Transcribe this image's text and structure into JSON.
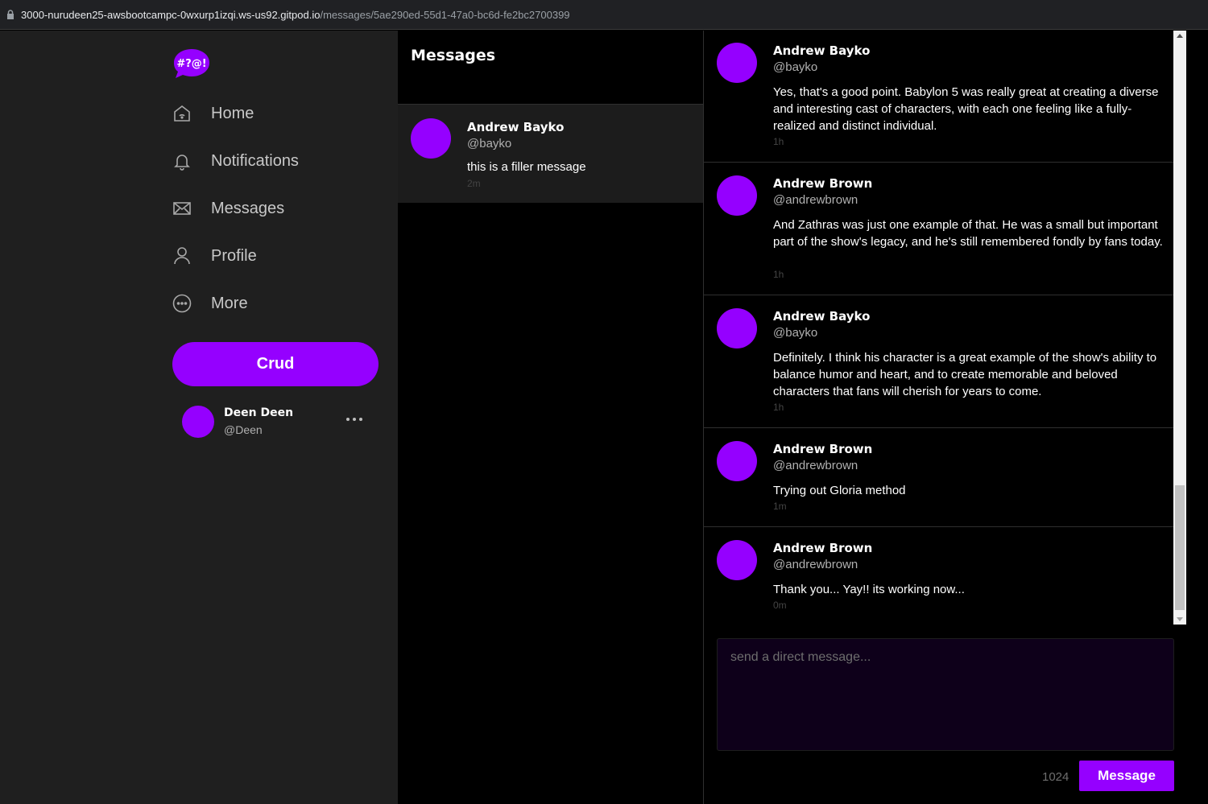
{
  "browser": {
    "url_host": "3000-nurudeen25-awsbootcampc-0wxurp1izqi.ws-us92.gitpod.io",
    "url_path": "/messages/5ae290ed-55d1-47a0-bc6d-fe2bc2700399"
  },
  "sidebar": {
    "logo_text": "#?@!",
    "items": [
      {
        "label": "Home",
        "icon": "home-icon"
      },
      {
        "label": "Notifications",
        "icon": "bell-icon"
      },
      {
        "label": "Messages",
        "icon": "envelope-icon"
      },
      {
        "label": "Profile",
        "icon": "user-icon"
      },
      {
        "label": "More",
        "icon": "more-circle-icon"
      }
    ],
    "crud_label": "Crud",
    "profile": {
      "name": "Deen Deen",
      "handle": "@Deen"
    }
  },
  "groups": {
    "title": "Messages",
    "items": [
      {
        "name": "Andrew Bayko",
        "handle": "@bayko",
        "message": "this is a filler message",
        "time": "2m"
      }
    ]
  },
  "feed": {
    "messages": [
      {
        "name": "Andrew Bayko",
        "handle": "@bayko",
        "text": "Yes, that's a good point. Babylon 5 was really great at creating a diverse and interesting cast of characters, with each one feeling like a fully-realized and distinct individual.",
        "time": "1h"
      },
      {
        "name": "Andrew Brown",
        "handle": "@andrewbrown",
        "text": "And Zathras was just one example of that. He was a small but important part of the show's legacy, and he's still remembered fondly by fans today.",
        "time": "1h"
      },
      {
        "name": "Andrew Bayko",
        "handle": "@bayko",
        "text": "Definitely. I think his character is a great example of the show's ability to balance humor and heart, and to create memorable and beloved characters that fans will cherish for years to come.",
        "time": "1h"
      },
      {
        "name": "Andrew Brown",
        "handle": "@andrewbrown",
        "text": "Trying out Gloria method",
        "time": "1m"
      },
      {
        "name": "Andrew Brown",
        "handle": "@andrewbrown",
        "text": "Thank you... Yay!! its working now...",
        "time": "0m"
      }
    ]
  },
  "composer": {
    "placeholder": "send a direct message...",
    "value": "",
    "char_count": "1024",
    "send_label": "Message"
  },
  "colors": {
    "accent": "#9500ff",
    "sidebar_bg": "#1f1f1f",
    "feed_bg": "#000000",
    "composer_bg": "#0e001a"
  }
}
